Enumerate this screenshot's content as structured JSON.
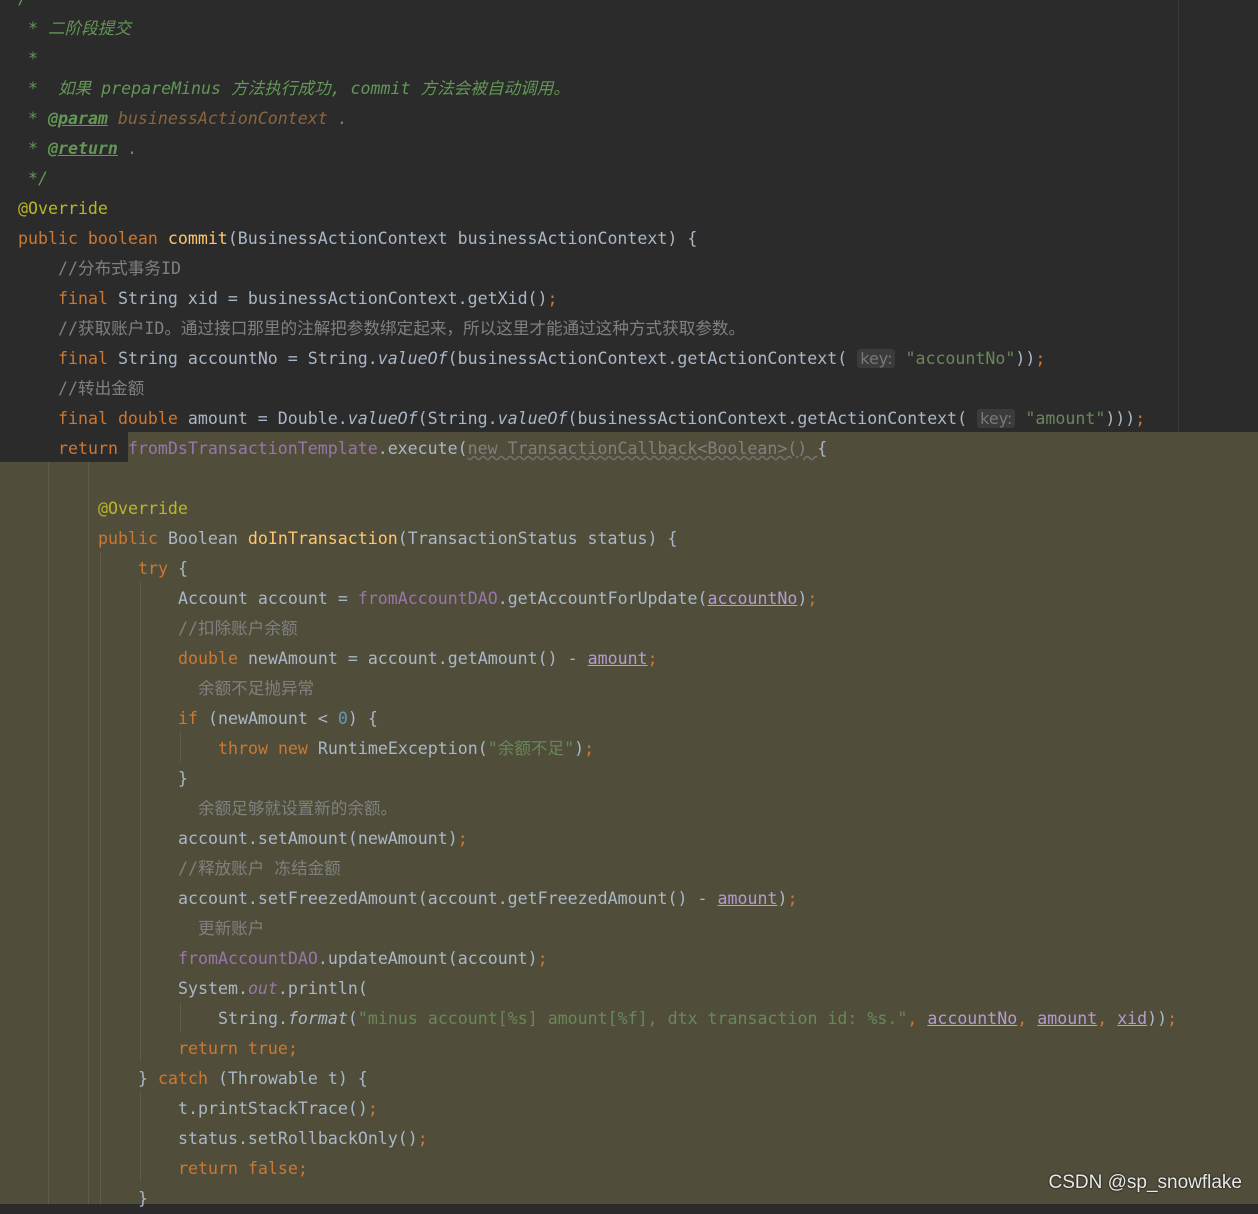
{
  "theme": {
    "background": "#2b2b2b",
    "highlight": "#504e3a",
    "keyword": "#cc7832",
    "string": "#6a8759",
    "comment": "#808080",
    "doc_comment": "#629755",
    "annotation": "#bbb529",
    "field": "#9876aa"
  },
  "code": [
    {
      "i": 0,
      "s": [
        [
          "dc",
          "/**"
        ]
      ]
    },
    {
      "i": 0,
      "s": [
        [
          "dc",
          " * 二阶段提交"
        ]
      ]
    },
    {
      "i": 0,
      "s": [
        [
          "dc",
          " *"
        ]
      ]
    },
    {
      "i": 0,
      "s": [
        [
          "dc",
          " *  如果 prepareMinus 方法执行成功, commit 方法会被自动调用。"
        ]
      ]
    },
    {
      "i": 0,
      "s": [
        [
          "dc",
          " * "
        ],
        [
          "dt",
          "@param"
        ],
        [
          "dp",
          " businessActionContext"
        ],
        [
          "dc",
          " ."
        ]
      ]
    },
    {
      "i": 0,
      "s": [
        [
          "dc",
          " * "
        ],
        [
          "dt",
          "@return"
        ],
        [
          "dc",
          " ."
        ]
      ]
    },
    {
      "i": 0,
      "s": [
        [
          "dc",
          " */"
        ]
      ]
    },
    {
      "i": 0,
      "s": [
        [
          "an",
          "@Override"
        ]
      ]
    },
    {
      "i": 0,
      "s": [
        [
          "kw",
          "public boolean "
        ],
        [
          "fn",
          "commit"
        ],
        [
          "id",
          "(BusinessActionContext businessActionContext) {"
        ]
      ]
    },
    {
      "i": 1,
      "s": [
        [
          "cm",
          "//分布式事务ID"
        ]
      ]
    },
    {
      "i": 1,
      "s": [
        [
          "kw",
          "final "
        ],
        [
          "id",
          "String xid = businessActionContext.getXid()"
        ],
        [
          "pu",
          ";"
        ]
      ]
    },
    {
      "i": 1,
      "s": [
        [
          "cm",
          "//获取账户ID。通过接口那里的注解把参数绑定起来，所以这里才能通过这种方式获取参数。"
        ]
      ]
    },
    {
      "i": 1,
      "s": [
        [
          "kw",
          "final "
        ],
        [
          "id",
          "String accountNo = String."
        ],
        [
          "it",
          "valueOf"
        ],
        [
          "id",
          "(businessActionContext.getActionContext( "
        ],
        [
          "hint",
          "key:"
        ],
        [
          "st",
          " \"accountNo\""
        ],
        [
          "id",
          "))"
        ],
        [
          "pu",
          ";"
        ]
      ]
    },
    {
      "i": 1,
      "s": [
        [
          "cm",
          "//转出金额"
        ]
      ]
    },
    {
      "i": 1,
      "s": [
        [
          "kw",
          "final double "
        ],
        [
          "id",
          "amount = Double."
        ],
        [
          "it",
          "valueOf"
        ],
        [
          "id",
          "(String."
        ],
        [
          "it",
          "valueOf"
        ],
        [
          "id",
          "(businessActionContext.getActionContext( "
        ],
        [
          "hint",
          "key:"
        ],
        [
          "st",
          " \"amount\""
        ],
        [
          "id",
          ")))"
        ],
        [
          "pu",
          ";"
        ]
      ]
    },
    {
      "i": 1,
      "s": [
        [
          "kw",
          "return "
        ],
        [
          "fd",
          "fromDsTransactionTemplate"
        ],
        [
          "id",
          ".execute("
        ],
        [
          "dim",
          "new TransactionCallback<Boolean>() "
        ],
        [
          "id",
          "{"
        ]
      ]
    },
    {
      "i": 0,
      "s": []
    },
    {
      "i": 2,
      "s": [
        [
          "an",
          "@Override"
        ]
      ]
    },
    {
      "i": 2,
      "s": [
        [
          "kw",
          "public "
        ],
        [
          "id",
          "Boolean "
        ],
        [
          "fn",
          "doInTransaction"
        ],
        [
          "id",
          "(TransactionStatus status) {"
        ]
      ]
    },
    {
      "i": 3,
      "s": [
        [
          "kw",
          "try "
        ],
        [
          "id",
          "{"
        ]
      ]
    },
    {
      "i": 4,
      "s": [
        [
          "id",
          "Account account = "
        ],
        [
          "fd",
          "fromAccountDAO"
        ],
        [
          "id",
          ".getAccountForUpdate("
        ],
        [
          "pv",
          "accountNo"
        ],
        [
          "id",
          ")"
        ],
        [
          "pu",
          ";"
        ]
      ]
    },
    {
      "i": 4,
      "s": [
        [
          "cm",
          "//扣除账户余额"
        ]
      ]
    },
    {
      "i": 4,
      "s": [
        [
          "kw",
          "double "
        ],
        [
          "id",
          "newAmount = account.getAmount() - "
        ],
        [
          "pv",
          "amount"
        ],
        [
          "pu",
          ";"
        ]
      ]
    },
    {
      "i": 4,
      "s": [
        [
          "cm",
          "  余额不足抛异常"
        ]
      ]
    },
    {
      "i": 4,
      "s": [
        [
          "kw",
          "if "
        ],
        [
          "id",
          "(newAmount < "
        ],
        [
          "nu",
          "0"
        ],
        [
          "id",
          ") {"
        ]
      ]
    },
    {
      "i": 5,
      "s": [
        [
          "kw",
          "throw new "
        ],
        [
          "id",
          "RuntimeException("
        ],
        [
          "st",
          "\"余额不足\""
        ],
        [
          "id",
          ")"
        ],
        [
          "pu",
          ";"
        ]
      ]
    },
    {
      "i": 4,
      "s": [
        [
          "id",
          "}"
        ]
      ]
    },
    {
      "i": 4,
      "s": [
        [
          "cm",
          "  余额足够就设置新的余额。"
        ]
      ]
    },
    {
      "i": 4,
      "s": [
        [
          "id",
          "account.setAmount(newAmount)"
        ],
        [
          "pu",
          ";"
        ]
      ]
    },
    {
      "i": 4,
      "s": [
        [
          "cm",
          "//释放账户 冻结金额"
        ]
      ]
    },
    {
      "i": 4,
      "s": [
        [
          "id",
          "account.setFreezedAmount(account.getFreezedAmount() - "
        ],
        [
          "pv",
          "amount"
        ],
        [
          "id",
          ")"
        ],
        [
          "pu",
          ";"
        ]
      ]
    },
    {
      "i": 4,
      "s": [
        [
          "cm",
          "  更新账户"
        ]
      ]
    },
    {
      "i": 4,
      "s": [
        [
          "fd",
          "fromAccountDAO"
        ],
        [
          "id",
          ".updateAmount(account)"
        ],
        [
          "pu",
          ";"
        ]
      ]
    },
    {
      "i": 4,
      "s": [
        [
          "id",
          "System."
        ],
        [
          "fi",
          "out"
        ],
        [
          "id",
          ".println("
        ]
      ]
    },
    {
      "i": 5,
      "s": [
        [
          "id",
          "String."
        ],
        [
          "it",
          "format"
        ],
        [
          "id",
          "("
        ],
        [
          "st",
          "\"minus account[%s] amount[%f], dtx transaction id: %s.\""
        ],
        [
          "pu",
          ", "
        ],
        [
          "pv",
          "accountNo"
        ],
        [
          "pu",
          ", "
        ],
        [
          "pv",
          "amount"
        ],
        [
          "pu",
          ", "
        ],
        [
          "pv",
          "xid"
        ],
        [
          "id",
          "))"
        ],
        [
          "pu",
          ";"
        ]
      ]
    },
    {
      "i": 4,
      "s": [
        [
          "kw",
          "return true;"
        ]
      ]
    },
    {
      "i": 3,
      "s": [
        [
          "id",
          "} "
        ],
        [
          "kw",
          "catch "
        ],
        [
          "id",
          "(Throwable t) {"
        ]
      ]
    },
    {
      "i": 4,
      "s": [
        [
          "id",
          "t.printStackTrace()"
        ],
        [
          "pu",
          ";"
        ]
      ]
    },
    {
      "i": 4,
      "s": [
        [
          "id",
          "status.setRollbackOnly()"
        ],
        [
          "pu",
          ";"
        ]
      ]
    },
    {
      "i": 4,
      "s": [
        [
          "kw",
          "return false;"
        ]
      ]
    },
    {
      "i": 3,
      "s": [
        [
          "id",
          "}"
        ]
      ]
    }
  ],
  "watermark": "CSDN @sp_snowflake"
}
